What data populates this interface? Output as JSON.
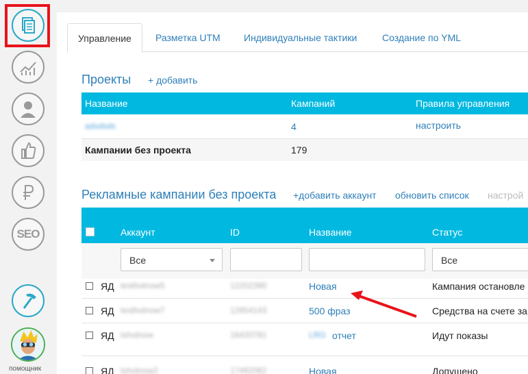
{
  "sidebar": {
    "items": [
      {
        "icon": "documents-icon",
        "active": true
      },
      {
        "icon": "chart-growth-icon"
      },
      {
        "icon": "user-icon"
      },
      {
        "icon": "thumbs-up-icon"
      },
      {
        "icon": "ruble-icon"
      },
      {
        "icon": "seo-icon",
        "label": "SEO"
      },
      {
        "icon": "hammer-icon"
      }
    ],
    "helper_label": "помощник"
  },
  "tabs": [
    {
      "label": "Управление",
      "active": true
    },
    {
      "label": "Разметка UTM"
    },
    {
      "label": "Индивидуальные тактики"
    },
    {
      "label": "Создание по YML"
    }
  ],
  "projects": {
    "title": "Проекты",
    "add_link": "+ добавить",
    "columns": [
      "Название",
      "Кампаний",
      "Правила управления"
    ],
    "rows": [
      {
        "name": "adsdsds",
        "campaigns": "4",
        "rules": "настроить"
      },
      {
        "name": "Кампании без проекта",
        "campaigns": "179",
        "rules": ""
      }
    ]
  },
  "campaigns": {
    "title": "Рекламные кампании без проекта",
    "add_account": "+добавить аккаунт",
    "refresh": "обновить список",
    "settings": "настрой",
    "columns": [
      "Аккаунт",
      "ID",
      "Название",
      "Статус"
    ],
    "filter_select": "Все",
    "filter_status": "Все",
    "rows": [
      {
        "type": "ЯД",
        "account": "testhotnow5",
        "id": "12202390",
        "name": "Новая",
        "status": "Кампания остановле"
      },
      {
        "type": "ЯД",
        "account": "testhotnow7",
        "id": "12654143",
        "name": "500 фраз",
        "status": "Средства на счете за"
      },
      {
        "type": "ЯД",
        "account": "tshotnow",
        "id": "16433781",
        "name_prefix": "LRG",
        "name": "отчет",
        "status": "Идут показы"
      },
      {
        "type": "ЯД",
        "account": "tshotnow2",
        "id": "17492082",
        "name": "Новая",
        "status": "Допущено модератор"
      }
    ]
  },
  "colors": {
    "accent": "#00b8e0",
    "link": "#2e7fb8",
    "highlight": "#e8131b"
  }
}
